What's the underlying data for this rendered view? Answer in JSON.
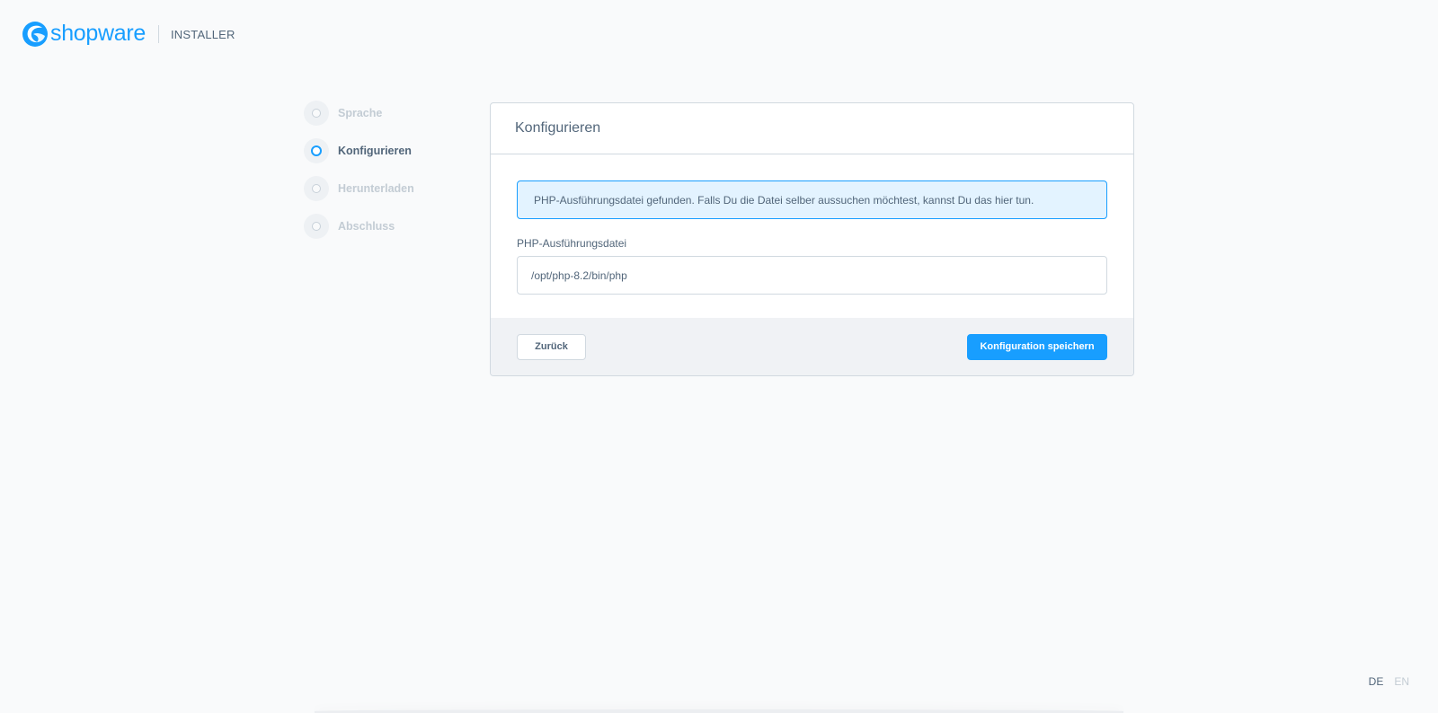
{
  "header": {
    "brand": "shopware",
    "label": "INSTALLER"
  },
  "steps": [
    {
      "label": "Sprache",
      "state": "inactive"
    },
    {
      "label": "Konfigurieren",
      "state": "active"
    },
    {
      "label": "Herunterladen",
      "state": "inactive"
    },
    {
      "label": "Abschluss",
      "state": "inactive"
    }
  ],
  "card": {
    "title": "Konfigurieren",
    "alert": "PHP-Ausführungsdatei gefunden. Falls Du die Datei selber aussuchen möchtest, kannst Du das hier tun.",
    "field": {
      "label": "PHP-Ausführungsdatei",
      "value": "/opt/php-8.2/bin/php"
    },
    "back_label": "Zurück",
    "submit_label": "Konfiguration speichern"
  },
  "lang": {
    "de": "DE",
    "en": "EN",
    "active": "DE"
  },
  "colors": {
    "accent": "#189eff",
    "text": "#52667a",
    "muted": "#c3ccd4",
    "background": "#f9fafb",
    "alert_bg": "#e3f3ff"
  }
}
